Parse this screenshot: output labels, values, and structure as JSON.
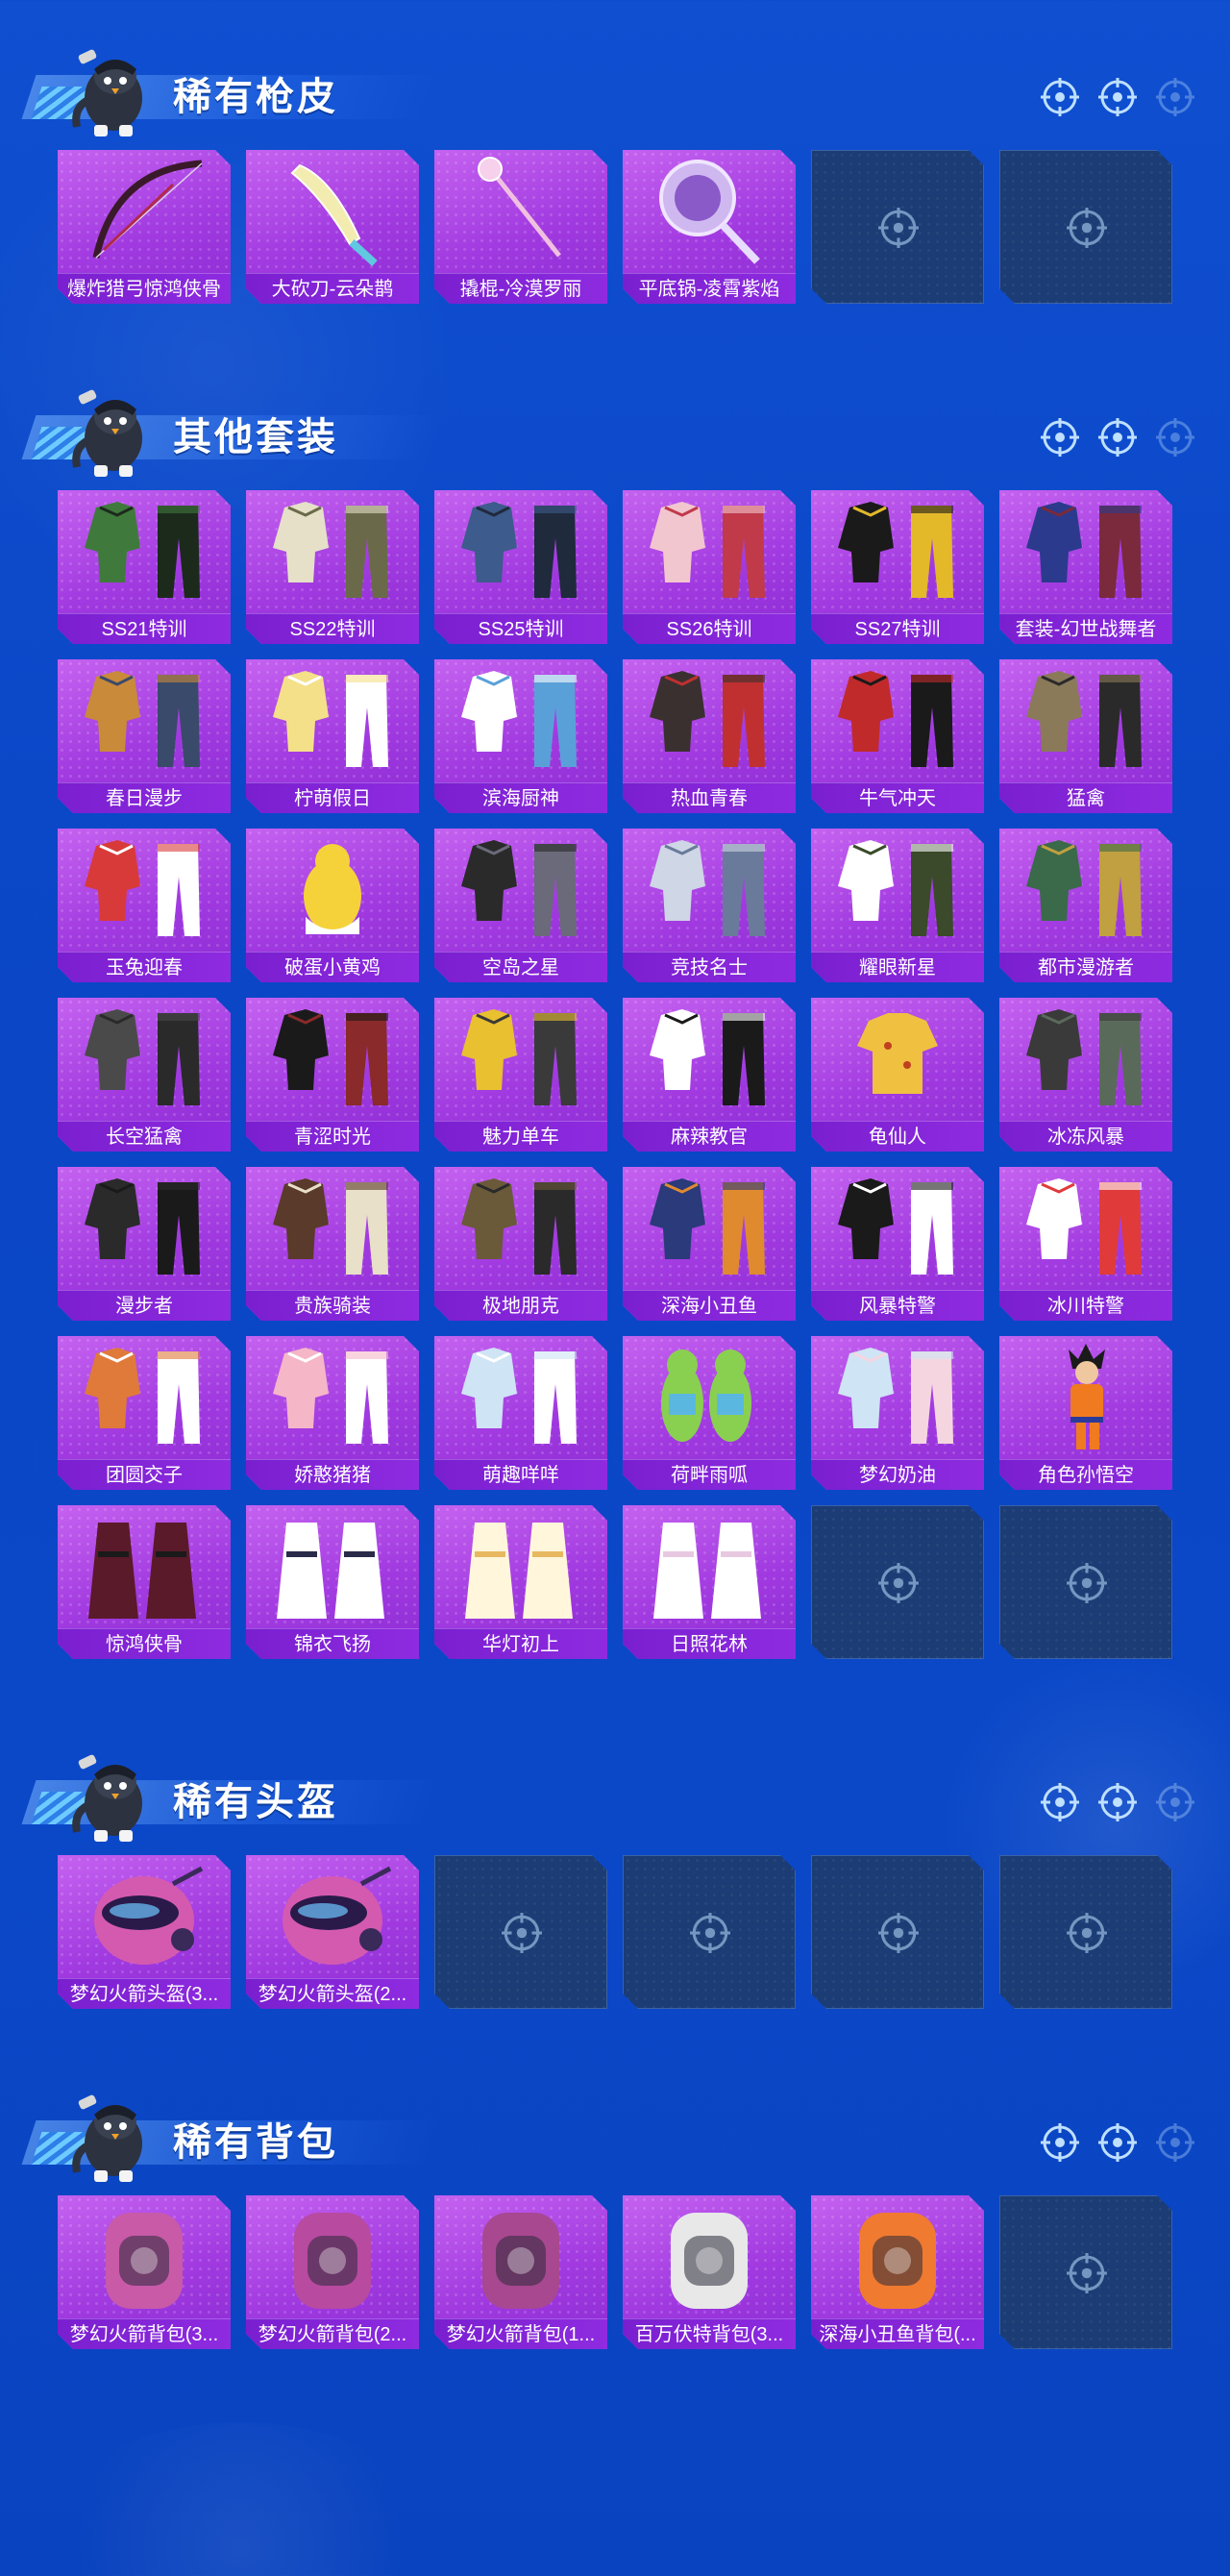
{
  "sections": [
    {
      "title": "稀有枪皮",
      "items": [
        {
          "label": "爆炸猎弓惊鸿侠骨",
          "art": "bow"
        },
        {
          "label": "大砍刀-云朵鹊",
          "art": "machete"
        },
        {
          "label": "撬棍-冷漠罗丽",
          "art": "staff"
        },
        {
          "label": "平底锅-凌霄紫焰",
          "art": "pan"
        },
        {
          "empty": true
        },
        {
          "empty": true
        }
      ]
    },
    {
      "title": "其他套装",
      "items": [
        {
          "label": "SS21特训",
          "art": "outfit",
          "c1": "#3f7a3c",
          "c2": "#1c2a1c"
        },
        {
          "label": "SS22特训",
          "art": "outfit",
          "c1": "#e6e0c8",
          "c2": "#6a6a4a"
        },
        {
          "label": "SS25特训",
          "art": "outfit",
          "c1": "#3d5b8c",
          "c2": "#1f2a3c"
        },
        {
          "label": "SS26特训",
          "art": "outfit",
          "c1": "#f2c6cf",
          "c2": "#c03a4a"
        },
        {
          "label": "SS27特训",
          "art": "outfit",
          "c1": "#1a1a1a",
          "c2": "#e3b92a"
        },
        {
          "label": "套装-幻世战舞者",
          "art": "outfit",
          "c1": "#2b3a8c",
          "c2": "#7a2a3c"
        },
        {
          "label": "春日漫步",
          "art": "outfit",
          "c1": "#c98a3a",
          "c2": "#3a4a6a"
        },
        {
          "label": "柠萌假日",
          "art": "outfit",
          "c1": "#f5e08a",
          "c2": "#ffffff"
        },
        {
          "label": "滨海厨神",
          "art": "outfit",
          "c1": "#ffffff",
          "c2": "#5aa0d8"
        },
        {
          "label": "热血青春",
          "art": "outfit",
          "c1": "#3a3030",
          "c2": "#c03030"
        },
        {
          "label": "牛气冲天",
          "art": "outfit",
          "c1": "#c02a2a",
          "c2": "#1a1a1a"
        },
        {
          "label": "猛禽",
          "art": "outfit",
          "c1": "#8a7a5a",
          "c2": "#2a2a2a"
        },
        {
          "label": "玉兔迎春",
          "art": "outfit",
          "c1": "#d83a3a",
          "c2": "#ffffff"
        },
        {
          "label": "破蛋小黄鸡",
          "art": "chick",
          "c1": "#f5d23a",
          "c2": "#ffffff"
        },
        {
          "label": "空岛之星",
          "art": "outfit",
          "c1": "#2a2a2a",
          "c2": "#6a6a7a"
        },
        {
          "label": "竞技名士",
          "art": "outfit",
          "c1": "#cfd6e6",
          "c2": "#6a7a9a"
        },
        {
          "label": "耀眼新星",
          "art": "outfit",
          "c1": "#ffffff",
          "c2": "#3a4a2a"
        },
        {
          "label": "都市漫游者",
          "art": "outfit",
          "c1": "#3a6a4a",
          "c2": "#c0a040"
        },
        {
          "label": "长空猛禽",
          "art": "outfit",
          "c1": "#4a4a4a",
          "c2": "#2a2a2a"
        },
        {
          "label": "青涩时光",
          "art": "outfit",
          "c1": "#1a1a1a",
          "c2": "#8a2a2a"
        },
        {
          "label": "魅力单车",
          "art": "outfit",
          "c1": "#e8c030",
          "c2": "#3a3a3a"
        },
        {
          "label": "麻辣教官",
          "art": "outfit",
          "c1": "#ffffff",
          "c2": "#1a1a1a"
        },
        {
          "label": "龟仙人",
          "art": "shirt",
          "c1": "#f0c040",
          "c2": "#ffffff"
        },
        {
          "label": "冰冻风暴",
          "art": "outfit",
          "c1": "#3a3a3a",
          "c2": "#5a6a5a"
        },
        {
          "label": "漫步者",
          "art": "outfit",
          "c1": "#2a2a2a",
          "c2": "#1a1a1a"
        },
        {
          "label": "贵族骑装",
          "art": "outfit",
          "c1": "#5a3a2a",
          "c2": "#e8e0c8"
        },
        {
          "label": "极地朋克",
          "art": "outfit",
          "c1": "#6a5a3a",
          "c2": "#2a2a2a"
        },
        {
          "label": "深海小丑鱼",
          "art": "outfit",
          "c1": "#2a3a7a",
          "c2": "#e08a30"
        },
        {
          "label": "风暴特警",
          "art": "outfit",
          "c1": "#1a1a1a",
          "c2": "#ffffff"
        },
        {
          "label": "冰川特警",
          "art": "outfit",
          "c1": "#ffffff",
          "c2": "#e03a3a"
        },
        {
          "label": "团圆交子",
          "art": "outfit",
          "c1": "#e07a3a",
          "c2": "#ffffff"
        },
        {
          "label": "娇憨猪猪",
          "art": "outfit",
          "c1": "#f5b6c8",
          "c2": "#ffffff"
        },
        {
          "label": "萌趣咩咩",
          "art": "outfit",
          "c1": "#cfe4f5",
          "c2": "#ffffff"
        },
        {
          "label": "荷畔雨呱",
          "art": "frog",
          "c1": "#8ad050",
          "c2": "#5ab8e0"
        },
        {
          "label": "梦幻奶油",
          "art": "outfit",
          "c1": "#cfe4f5",
          "c2": "#f5d6e0"
        },
        {
          "label": "角色孙悟空",
          "art": "goku",
          "c1": "#f07a20",
          "c2": "#2a3a9a"
        },
        {
          "label": "惊鸿侠骨",
          "art": "robe",
          "c1": "#5a1a2a",
          "c2": "#1a1a1a"
        },
        {
          "label": "锦衣飞扬",
          "art": "robe",
          "c1": "#ffffff",
          "c2": "#2a2a4a"
        },
        {
          "label": "华灯初上",
          "art": "robe",
          "c1": "#fff6dc",
          "c2": "#e8b860"
        },
        {
          "label": "日照花林",
          "art": "robe",
          "c1": "#ffffff",
          "c2": "#e8c8e0"
        },
        {
          "empty": true
        },
        {
          "empty": true
        }
      ]
    },
    {
      "title": "稀有头盔",
      "items": [
        {
          "label": "梦幻火箭头盔(3...",
          "art": "helmet"
        },
        {
          "label": "梦幻火箭头盔(2...",
          "art": "helmet"
        },
        {
          "empty": true
        },
        {
          "empty": true
        },
        {
          "empty": true
        },
        {
          "empty": true
        }
      ]
    },
    {
      "title": "稀有背包",
      "items": [
        {
          "label": "梦幻火箭背包(3...",
          "art": "backpack",
          "c1": "#c85aa8"
        },
        {
          "label": "梦幻火箭背包(2...",
          "art": "backpack",
          "c1": "#b84aa0"
        },
        {
          "label": "梦幻火箭背包(1...",
          "art": "backpack",
          "c1": "#a84890"
        },
        {
          "label": "百万伏特背包(3...",
          "art": "backpack",
          "c1": "#e8e8e8"
        },
        {
          "label": "深海小丑鱼背包(...",
          "art": "backpack",
          "c1": "#f07a30"
        },
        {
          "empty": true
        }
      ]
    }
  ]
}
